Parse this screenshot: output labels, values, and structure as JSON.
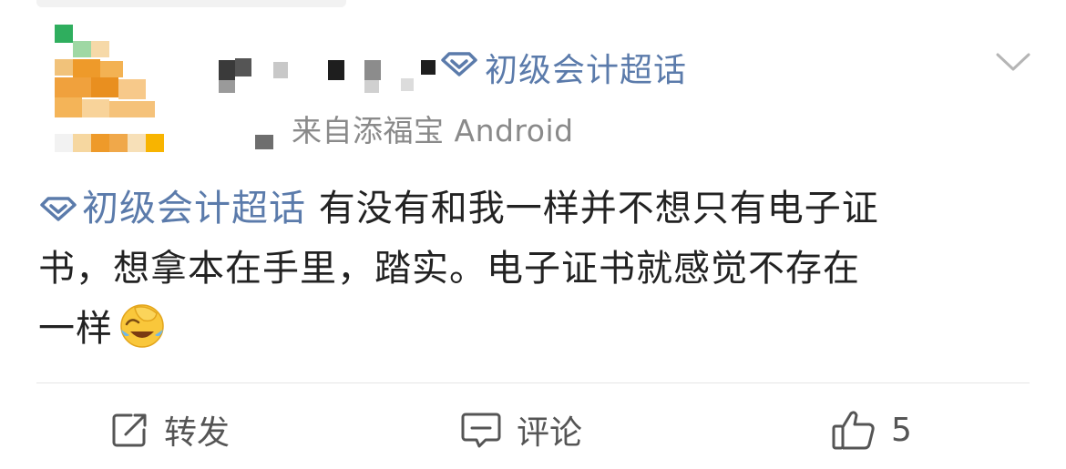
{
  "post": {
    "topic": "初级会计超话",
    "source": "来自添福宝 Android",
    "content": {
      "topic": "初级会计超话",
      "text_line1": " 有没有和我一样并不想只有电子证",
      "text_line2": "书，想拿本在手里，踏实。电子证书就感觉不存在",
      "text_line3": "一样"
    },
    "emoji": "laugh-cry-cover-face"
  },
  "actions": {
    "repost_label": "转发",
    "comment_label": "评论",
    "like_count": "5"
  },
  "colors": {
    "accent": "#5b7bab",
    "text": "#222222",
    "secondary": "#8a8a8a"
  }
}
